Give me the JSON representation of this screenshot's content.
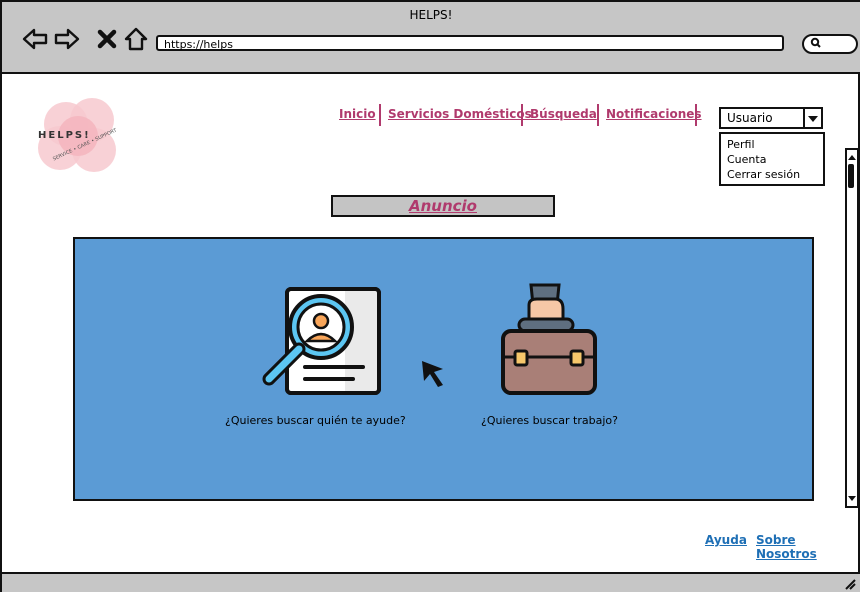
{
  "browser": {
    "title": "HELPS!",
    "url": "https://helps",
    "icons": [
      "back-arrow-icon",
      "forward-arrow-icon",
      "close-icon",
      "home-icon",
      "search-icon"
    ]
  },
  "logo": {
    "text": "HELPS!",
    "subtext": "SERVICE • CARE • SUPPORT"
  },
  "nav": {
    "items": [
      {
        "label": "Inicio"
      },
      {
        "label": "Servicios Domésticos"
      },
      {
        "label": "Búsqueda"
      },
      {
        "label": "Notificaciones"
      }
    ]
  },
  "user_menu": {
    "selected": "Usuario",
    "options": [
      "Perfil",
      "Cuenta",
      "Cerrar sesión"
    ]
  },
  "banner": {
    "label": "Anuncio"
  },
  "cards": [
    {
      "icon": "search-person-icon",
      "caption": "¿Quieres buscar quién te ayude?"
    },
    {
      "icon": "briefcase-icon",
      "caption": "¿Quieres buscar trabajo?"
    }
  ],
  "footer": {
    "help": "Ayuda",
    "about": "Sobre Nosotros"
  },
  "colors": {
    "accent": "#b03a6d",
    "panel": "#5b9bd5",
    "link": "#1e6fb5",
    "chrome": "#c6c6c6"
  }
}
